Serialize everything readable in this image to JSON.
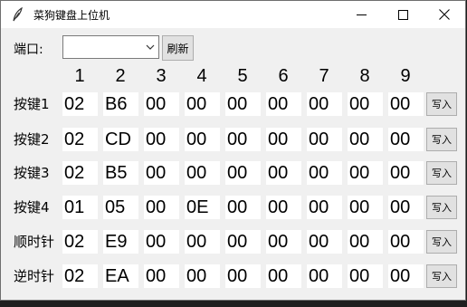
{
  "window": {
    "title": "菜狗键盘上位机"
  },
  "port": {
    "label": "端口:",
    "selected": "",
    "refresh_label": "刷新"
  },
  "columns": [
    "1",
    "2",
    "3",
    "4",
    "5",
    "6",
    "7",
    "8",
    "9"
  ],
  "rows": [
    {
      "label": "按键1",
      "values": [
        "02",
        "B6",
        "00",
        "00",
        "00",
        "00",
        "00",
        "00",
        "00"
      ],
      "button": "写入"
    },
    {
      "label": "按键2",
      "values": [
        "02",
        "CD",
        "00",
        "00",
        "00",
        "00",
        "00",
        "00",
        "00"
      ],
      "button": "写入"
    },
    {
      "label": "按键3",
      "values": [
        "02",
        "B5",
        "00",
        "00",
        "00",
        "00",
        "00",
        "00",
        "00"
      ],
      "button": "写入"
    },
    {
      "label": "按键4",
      "values": [
        "01",
        "05",
        "00",
        "0E",
        "00",
        "00",
        "00",
        "00",
        "00"
      ],
      "button": "写入"
    },
    {
      "label": "顺时针",
      "values": [
        "02",
        "E9",
        "00",
        "00",
        "00",
        "00",
        "00",
        "00",
        "00"
      ],
      "button": "写入"
    },
    {
      "label": "逆时针",
      "values": [
        "02",
        "EA",
        "00",
        "00",
        "00",
        "00",
        "00",
        "00",
        "00"
      ],
      "button": "写入"
    }
  ]
}
